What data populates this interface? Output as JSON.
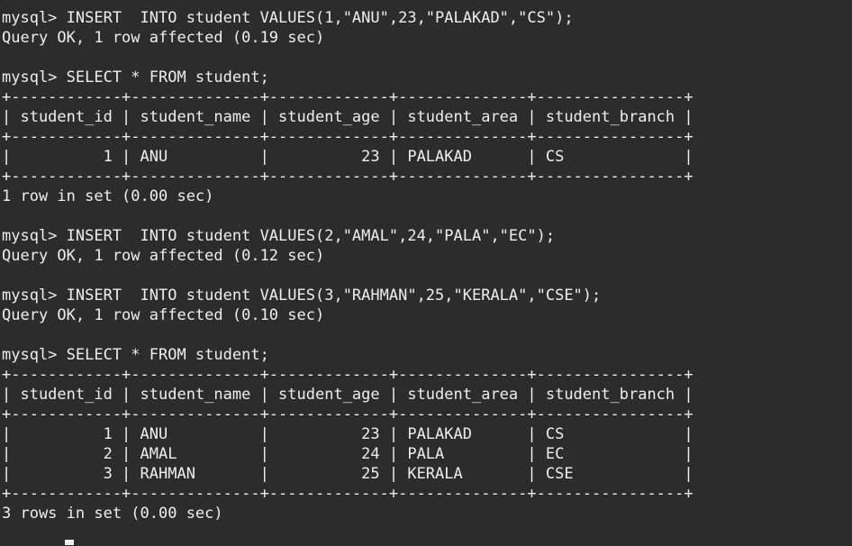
{
  "terminal": {
    "lines": [
      "mysql> INSERT  INTO student VALUES(1,\"ANU\",23,\"PALAKAD\",\"CS\");",
      "Query OK, 1 row affected (0.19 sec)",
      "",
      "mysql> SELECT * FROM student;",
      "+------------+--------------+-------------+--------------+----------------+",
      "| student_id | student_name | student_age | student_area | student_branch |",
      "+------------+--------------+-------------+--------------+----------------+",
      "|          1 | ANU          |          23 | PALAKAD      | CS             |",
      "+------------+--------------+-------------+--------------+----------------+",
      "1 row in set (0.00 sec)",
      "",
      "mysql> INSERT  INTO student VALUES(2,\"AMAL\",24,\"PALA\",\"EC\");",
      "Query OK, 1 row affected (0.12 sec)",
      "",
      "mysql> INSERT  INTO student VALUES(3,\"RAHMAN\",25,\"KERALA\",\"CSE\");",
      "Query OK, 1 row affected (0.10 sec)",
      "",
      "mysql> SELECT * FROM student;",
      "+------------+--------------+-------------+--------------+----------------+",
      "| student_id | student_name | student_age | student_area | student_branch |",
      "+------------+--------------+-------------+--------------+----------------+",
      "|          1 | ANU          |          23 | PALAKAD      | CS             |",
      "|          2 | AMAL         |          24 | PALA         | EC             |",
      "|          3 | RAHMAN       |          25 | KERALA       | CSE            |",
      "+------------+--------------+-------------+--------------+----------------+",
      "3 rows in set (0.00 sec)"
    ]
  },
  "colors": {
    "background": "#2c2c2c",
    "foreground": "#eeeeee"
  }
}
